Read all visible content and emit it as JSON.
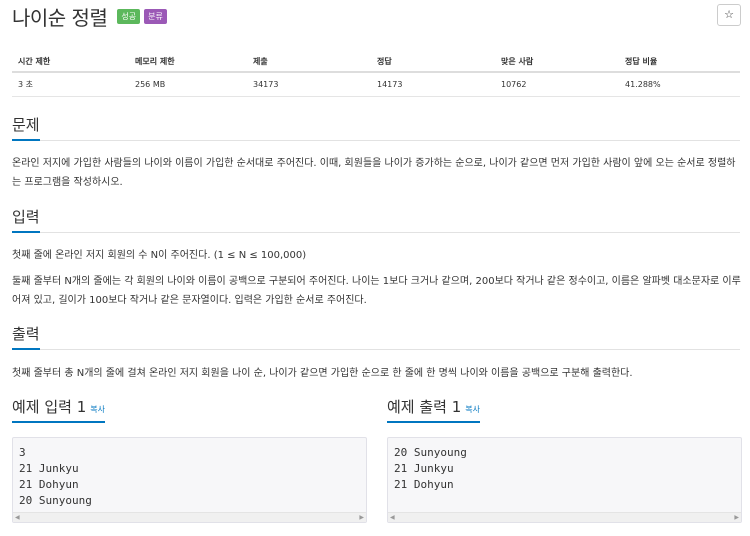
{
  "problem": {
    "title": "나이순 정렬",
    "badges": {
      "solved": "성공",
      "category": "분류"
    },
    "star": "☆"
  },
  "info_table": {
    "headers": [
      "시간 제한",
      "메모리 제한",
      "제출",
      "정답",
      "맞은 사람",
      "정답 비율"
    ],
    "values": [
      "3 초",
      "256 MB",
      "34173",
      "14173",
      "10762",
      "41.288%"
    ]
  },
  "sections": {
    "problem_heading": "문제",
    "problem_text": "온라인 저지에 가입한 사람들의 나이와 이름이 가입한 순서대로 주어진다. 이때, 회원들을 나이가 증가하는 순으로, 나이가 같으면 먼저 가입한 사람이 앞에 오는 순서로 정렬하는 프로그램을 작성하시오.",
    "input_heading": "입력",
    "input_text_1": "첫째 줄에 온라인 저지 회원의 수 N이 주어진다. (1 ≤ N ≤ 100,000)",
    "input_text_2": "둘째 줄부터 N개의 줄에는 각 회원의 나이와 이름이 공백으로 구분되어 주어진다. 나이는 1보다 크거나 같으며, 200보다 작거나 같은 정수이고, 이름은 알파벳 대소문자로 이루어져 있고, 길이가 100보다 작거나 같은 문자열이다. 입력은 가입한 순서로 주어진다.",
    "output_heading": "출력",
    "output_text": "첫째 줄부터 총 N개의 줄에 걸쳐 온라인 저지 회원을 나이 순, 나이가 같으면 가입한 순으로 한 줄에 한 명씩 나이와 이름을 공백으로 구분해 출력한다."
  },
  "samples": {
    "input_heading": "예제 입력 1",
    "output_heading": "예제 출력 1",
    "copy_label": "복사",
    "input_text": "3\n21 Junkyu\n21 Dohyun\n20 Sunyoung",
    "output_text": "20 Sunyoung\n21 Junkyu\n21 Dohyun"
  },
  "colors": {
    "accent": "#0076c0",
    "badge_green": "#5cb85c",
    "badge_purple": "#9b59b6"
  }
}
